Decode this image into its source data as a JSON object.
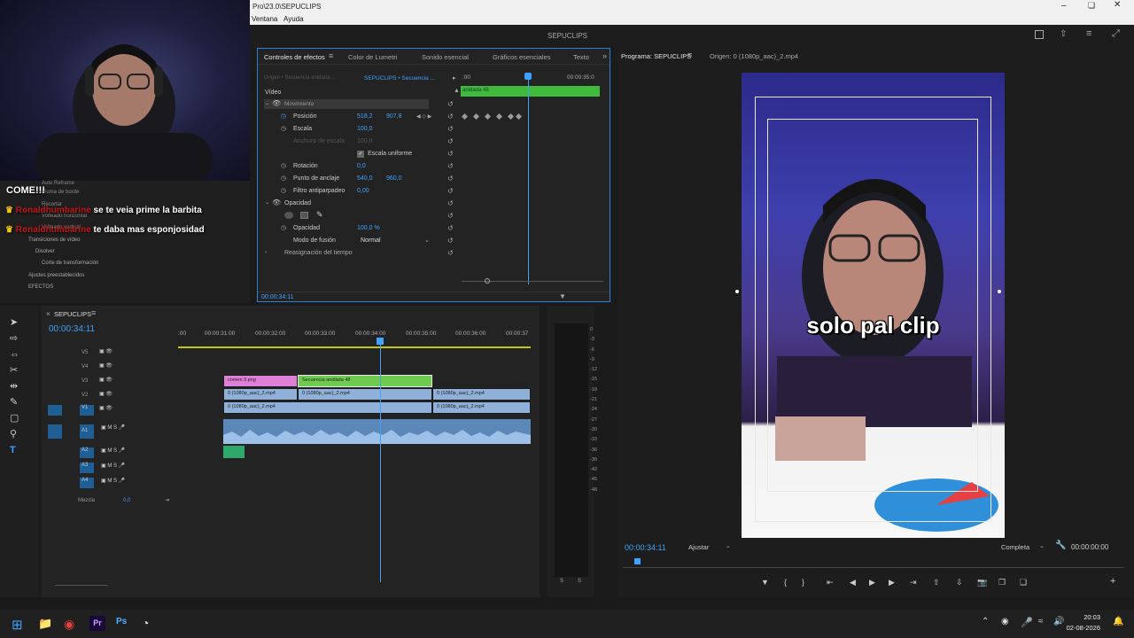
{
  "window": {
    "title": "Pro\\23.0\\SEPUCLIPS",
    "menu": [
      "Ventana",
      "Ayuda"
    ],
    "project": "SEPUCLIPS"
  },
  "chat": {
    "lines": [
      {
        "user": "",
        "text": "COME!!!"
      },
      {
        "user": "Ronaldhumbarine",
        "text": "se te veia prime la barbita"
      },
      {
        "user": "Ronaldhumbarine",
        "text": "te daba mas esponjosidad"
      }
    ],
    "effects_list": [
      "Auto Reframe",
      "Pluma de borde",
      "Recortar",
      "Volteado horizontal",
      "Volteado vertical",
      "Transiciones de vídeo",
      "Disolver",
      "Corte de transformación",
      "Ajustes preestablecidos",
      "EFECTOS"
    ]
  },
  "effect_controls": {
    "tabs": [
      "Controles de efectos",
      "Color de Lumetri",
      "Sonido esencial",
      "Gráficos esenciales",
      "Texto"
    ],
    "source": "Origen • Secuencia anidada ...",
    "sequence": "SEPUCLIPS • Secuencia ...",
    "ruler": {
      "start": ":00",
      "end": "00:00:35:0"
    },
    "nested_clip": "anidada 48",
    "section": "Vídeo",
    "group": "Movimiento",
    "props": [
      {
        "name": "Posición",
        "v1": "518,2",
        "v2": "907,8"
      },
      {
        "name": "Escala",
        "v1": "100,0",
        "v2": ""
      },
      {
        "name": "Anchura de escala",
        "v1": "100,0",
        "v2": ""
      },
      {
        "name": "Escala uniforme",
        "v1": "",
        "v2": ""
      },
      {
        "name": "Rotación",
        "v1": "0,0",
        "v2": ""
      },
      {
        "name": "Punto de anclaje",
        "v1": "540,0",
        "v2": "960,0"
      },
      {
        "name": "Filtro antiparpadeo",
        "v1": "0,00",
        "v2": ""
      }
    ],
    "opacity_group": "Opacidad",
    "opacity": {
      "name": "Opacidad",
      "value": "100,0 %"
    },
    "blend": {
      "name": "Modo de fusión",
      "value": "Normal"
    },
    "remap": "Reasignación del tiempo",
    "timecode": "00:00:34:11"
  },
  "program": {
    "tab": "Programa: SEPUCLIPS",
    "source_tab": "Origen: 0 (1080p_aac)_2.mp4",
    "caption": "solo pal clip",
    "timecode": "00:00:34:11",
    "fit": "Ajustar",
    "quality": "Completa",
    "duration": "00:00:00:00"
  },
  "timeline": {
    "name": "SEPUCLIPS",
    "timecode": "00:00:34:11",
    "ruler": [
      ":00",
      "00:00:31:00",
      "00:00:32:00",
      "00:00:33:00",
      "00:00:34:00",
      "00:00:35:00",
      "00:00:36:00",
      "00:00:37"
    ],
    "video_tracks": [
      "V5",
      "V4",
      "V3",
      "V2",
      "V1"
    ],
    "audio_tracks": [
      "A1",
      "A2",
      "A3",
      "A4"
    ],
    "mix_label": "Mezcla",
    "mix_value": "0,0",
    "clips": [
      {
        "label": "comen 3.png",
        "track": "V3"
      },
      {
        "label": "Secuencia anidada 48",
        "track": "V3"
      },
      {
        "label": "0 (1080p_aac)_2.mp4",
        "track": "V2"
      },
      {
        "label": "0 (1080p_aac)_2.mp4",
        "track": "V2"
      },
      {
        "label": "0 (1080p_aac)_2.mp4",
        "track": "V2"
      },
      {
        "label": "0 (1080p_aac)_2.mp4",
        "track": "V1"
      },
      {
        "label": "0 (1080p_aac)_2.mp4",
        "track": "V1"
      }
    ]
  },
  "meter": {
    "scale": [
      "0",
      "-3",
      "-6",
      "-9",
      "-12",
      "-15",
      "-18",
      "-21",
      "-24",
      "-27",
      "-30",
      "-33",
      "-36",
      "-39",
      "-42",
      "-45",
      "-48"
    ],
    "bottom": [
      "S",
      "S"
    ]
  },
  "taskbar": {
    "time": "20:03",
    "date": "02-08-2026"
  },
  "colors": {
    "accent": "#2a7fd4",
    "clip_pink": "#e07fd8",
    "clip_green": "#6ecb4f",
    "clip_blue": "#8fb0d8",
    "timecode": "#3fa2ff"
  }
}
